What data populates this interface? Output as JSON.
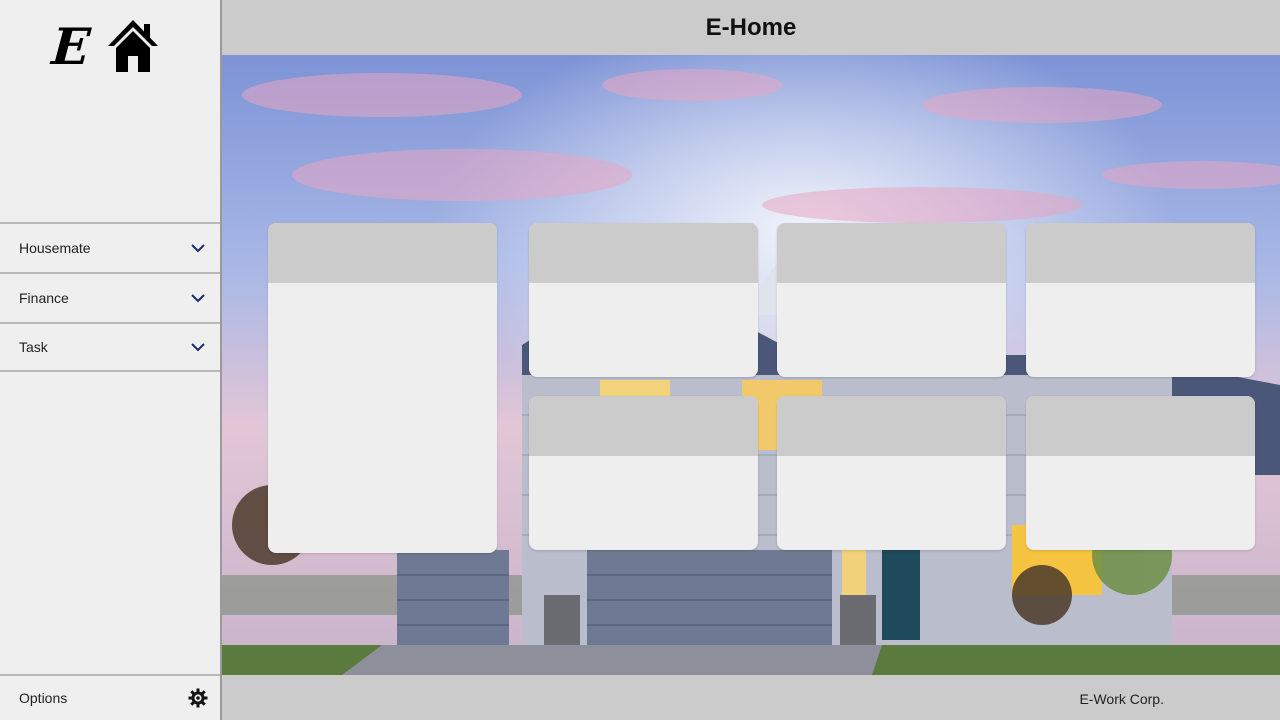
{
  "app": {
    "title": "E-Home",
    "logo_letter": "E"
  },
  "sidebar": {
    "items": [
      {
        "label": "Housemate"
      },
      {
        "label": "Finance"
      },
      {
        "label": "Task"
      }
    ],
    "options_label": "Options"
  },
  "footer": {
    "text": "E-Work Corp."
  },
  "cards": {
    "count": 7
  },
  "colors": {
    "panel": "#efefef",
    "bar": "#cbcbcb",
    "card": "#eeeeee",
    "card_header": "#cbcbcb",
    "chevron": "#1a2a6c"
  }
}
